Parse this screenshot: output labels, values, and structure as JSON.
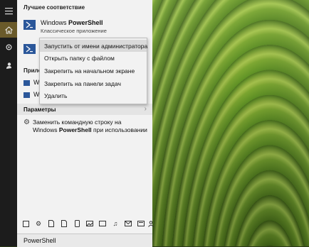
{
  "sections": {
    "best_match": "Лучшее соответствие",
    "apps_partial": "Прило",
    "settings": "Параметры"
  },
  "best_match": {
    "name_prefix": "Windows ",
    "name_bold": "PowerShell",
    "type": "Классическое приложение"
  },
  "apps": [
    {
      "label": "W"
    },
    {
      "label": "W"
    }
  ],
  "context_menu": [
    "Запустить от имени администратора",
    "Открыть папку с файлом",
    "Закрепить на начальном экране",
    "Закрепить на панели задач",
    "Удалить"
  ],
  "settings_item": {
    "line1": "Заменить командную строку на",
    "line2_prefix": "Windows ",
    "line2_bold": "PowerShell",
    "line2_suffix": " при использовании"
  },
  "search": {
    "query": "PowerShell"
  },
  "settings_chevron": "›",
  "filter_icons": [
    "apps-filter-icon",
    "settings-filter-icon",
    "documents-filter-icon",
    "tablet-filter-icon",
    "photos-filter-icon",
    "videos-filter-icon",
    "music-filter-icon",
    "email-filter-icon",
    "web-filter-icon",
    "people-filter-icon"
  ],
  "colors": {
    "accent": "#6a5a2a",
    "powershell_blue": "#2b579a",
    "rail_bg": "#1c1c1c",
    "panel_bg": "#f2f2f2"
  }
}
